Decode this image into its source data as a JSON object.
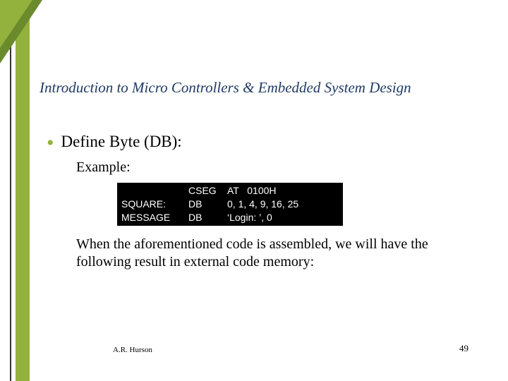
{
  "title": "Introduction to Micro Controllers & Embedded System Design",
  "bullet": "Define Byte (DB):",
  "example_label": "Example:",
  "code": {
    "rows": [
      {
        "label": "",
        "op": "CSEG",
        "args": "AT   0100H"
      },
      {
        "label": "SQUARE:",
        "op": "DB",
        "args": "0, 1, 4, 9, 16, 25"
      },
      {
        "label": "MESSAGE",
        "op": "DB",
        "args": "‘Login: ’, 0"
      }
    ]
  },
  "paragraph": "When the aforementioned code is assembled, we will have the following result in external code memory:",
  "footer": {
    "author": "A.R. Hurson",
    "page": "49"
  }
}
